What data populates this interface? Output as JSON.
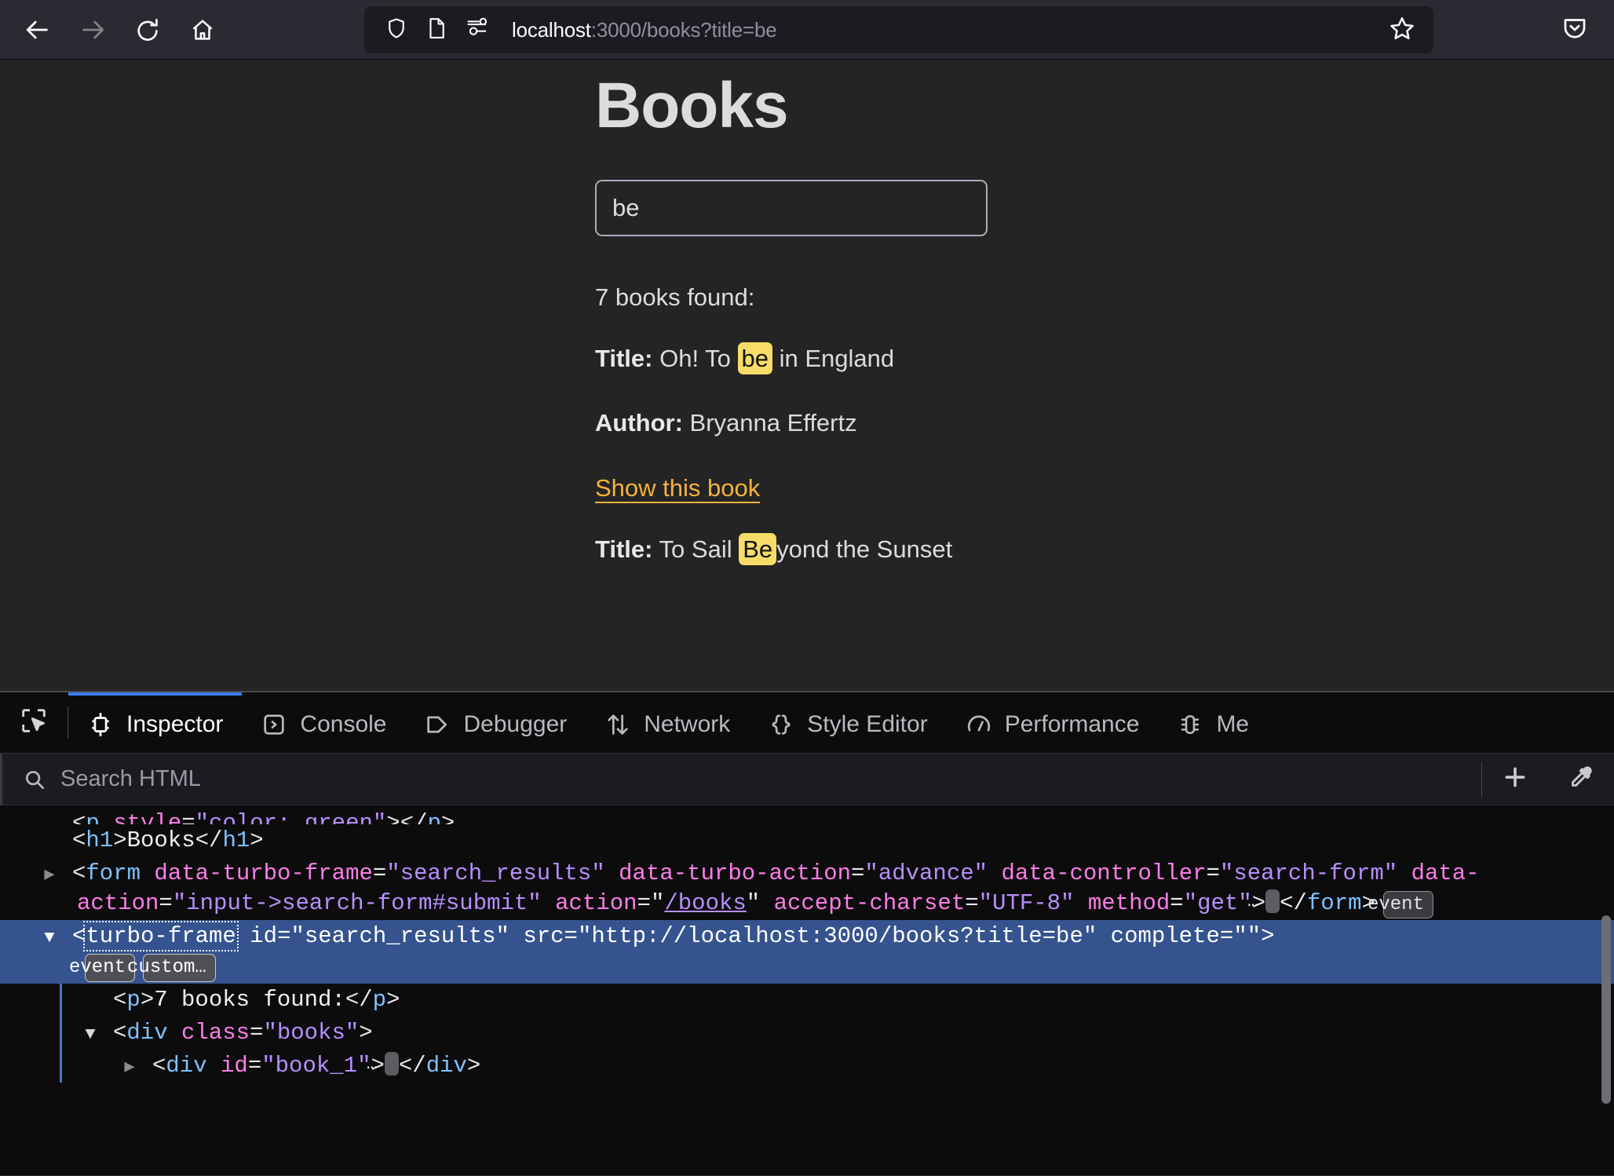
{
  "browser": {
    "nav": {
      "back": "back-arrow",
      "forward": "forward-arrow",
      "reload": "reload-arrow",
      "home": "home-house"
    },
    "url_bar": {
      "shield_icon": "shield-icon",
      "page_icon": "page-document-icon",
      "tracking_icon": "tracking-protection-icon",
      "host": "localhost",
      "path": ":3000/books?title=be",
      "full_url": "localhost:3000/books?title=be",
      "bookmark_icon": "star-icon"
    },
    "pocket_icon": "pocket-icon"
  },
  "page": {
    "title": "Books",
    "search": {
      "value": "be",
      "placeholder": ""
    },
    "results_count": "7 books found:",
    "books": [
      {
        "title_label": "Title:",
        "title_pre": " Oh! To ",
        "title_hl": "be",
        "title_post": " in England",
        "author_label": "Author:",
        "author_name": " Bryanna Effertz",
        "link": "Show this book"
      },
      {
        "title_label": "Title:",
        "title_pre": " To Sail ",
        "title_hl": "Be",
        "title_post": "yond the Sunset"
      }
    ]
  },
  "devtools": {
    "picker_icon": "element-picker-icon",
    "tabs": [
      {
        "label": "Inspector",
        "icon": "inspector-icon",
        "active": true
      },
      {
        "label": "Console",
        "icon": "console-icon",
        "active": false
      },
      {
        "label": "Debugger",
        "icon": "debugger-icon",
        "active": false
      },
      {
        "label": "Network",
        "icon": "network-icon",
        "active": false
      },
      {
        "label": "Style Editor",
        "icon": "style-editor-icon",
        "active": false
      },
      {
        "label": "Performance",
        "icon": "performance-icon",
        "active": false
      },
      {
        "label": "Me",
        "icon": "memory-icon",
        "active": false
      }
    ],
    "search_html": {
      "placeholder": "Search HTML",
      "value": "",
      "icon": "search-icon"
    },
    "add_node_icon": "plus-icon",
    "eyedropper_icon": "eyedropper-icon",
    "markup": {
      "rows": [
        {
          "id": "row-p-style",
          "clipped": true,
          "parts": [
            {
              "t": "punct",
              "v": "<"
            },
            {
              "t": "tag",
              "v": "p"
            },
            {
              "t": "attr",
              "v": " style"
            },
            {
              "t": "punct",
              "v": "="
            },
            {
              "t": "val",
              "v": "\"color: green\""
            },
            {
              "t": "punct",
              "v": ">"
            },
            {
              "t": "punct",
              "v": "</"
            },
            {
              "t": "tag",
              "v": "p"
            },
            {
              "t": "punct",
              "v": ">"
            }
          ]
        },
        {
          "id": "row-h1",
          "parts": [
            {
              "t": "punct",
              "v": "<"
            },
            {
              "t": "tag",
              "v": "h1"
            },
            {
              "t": "punct",
              "v": ">"
            },
            {
              "t": "txt",
              "v": "Books"
            },
            {
              "t": "punct",
              "v": "</"
            },
            {
              "t": "tag",
              "v": "h1"
            },
            {
              "t": "punct",
              "v": ">"
            }
          ]
        },
        {
          "id": "row-form",
          "twisty": "closed",
          "parts": [
            {
              "t": "punct",
              "v": "<"
            },
            {
              "t": "tag",
              "v": "form"
            },
            {
              "t": "attr",
              "v": " data-turbo-frame"
            },
            {
              "t": "punct",
              "v": "="
            },
            {
              "t": "val",
              "v": "\"search_results\""
            },
            {
              "t": "attr",
              "v": " data-turbo-action"
            },
            {
              "t": "punct",
              "v": "="
            },
            {
              "t": "val",
              "v": "\"advance\""
            },
            {
              "t": "attr",
              "v": " data-controller"
            },
            {
              "t": "punct",
              "v": "="
            },
            {
              "t": "val",
              "v": "\"search-form\""
            },
            {
              "t": "attr",
              "v": " data-action"
            },
            {
              "t": "punct",
              "v": "="
            },
            {
              "t": "val",
              "v": "\"input->search-form#submit\""
            },
            {
              "t": "attr",
              "v": " action"
            },
            {
              "t": "punct",
              "v": "="
            },
            {
              "t": "punct",
              "v": "\""
            },
            {
              "t": "val-link",
              "v": "/books"
            },
            {
              "t": "punct",
              "v": "\""
            },
            {
              "t": "attr",
              "v": " accept-charset"
            },
            {
              "t": "punct",
              "v": "="
            },
            {
              "t": "val",
              "v": "\"UTF-8\""
            },
            {
              "t": "attr",
              "v": " method"
            },
            {
              "t": "punct",
              "v": "="
            },
            {
              "t": "val",
              "v": "\"get\""
            },
            {
              "t": "punct",
              "v": ">"
            },
            {
              "t": "ellipsis",
              "v": "…"
            },
            {
              "t": "punct",
              "v": "</"
            },
            {
              "t": "tag",
              "v": "form"
            },
            {
              "t": "punct",
              "v": ">"
            },
            {
              "t": "badge",
              "v": "event"
            }
          ]
        },
        {
          "id": "row-turbo-frame",
          "selected": true,
          "twisty": "open",
          "parts": [
            {
              "t": "punct",
              "v": "<"
            },
            {
              "t": "tag-focus",
              "v": "turbo-frame"
            },
            {
              "t": "attr",
              "v": " id"
            },
            {
              "t": "punct",
              "v": "="
            },
            {
              "t": "val",
              "v": "\"search_results\""
            },
            {
              "t": "attr",
              "v": " src"
            },
            {
              "t": "punct",
              "v": "="
            },
            {
              "t": "val",
              "v": "\"http://localhost:3000/books?title=be\""
            },
            {
              "t": "attr",
              "v": " complete"
            },
            {
              "t": "punct",
              "v": "="
            },
            {
              "t": "val",
              "v": "\"\""
            },
            {
              "t": "punct",
              "v": ">"
            },
            {
              "t": "newline",
              "v": ""
            },
            {
              "t": "badge",
              "v": "event"
            },
            {
              "t": "badge",
              "v": "custom…"
            }
          ]
        },
        {
          "id": "row-p-found",
          "indent": 1,
          "parts": [
            {
              "t": "punct",
              "v": "<"
            },
            {
              "t": "tag",
              "v": "p"
            },
            {
              "t": "punct",
              "v": ">"
            },
            {
              "t": "txt",
              "v": "7 books found:"
            },
            {
              "t": "punct",
              "v": "</"
            },
            {
              "t": "tag",
              "v": "p"
            },
            {
              "t": "punct",
              "v": ">"
            }
          ]
        },
        {
          "id": "row-div-books",
          "indent": 1,
          "twisty": "open",
          "parts": [
            {
              "t": "punct",
              "v": "<"
            },
            {
              "t": "tag",
              "v": "div"
            },
            {
              "t": "attr",
              "v": " class"
            },
            {
              "t": "punct",
              "v": "="
            },
            {
              "t": "val",
              "v": "\"books\""
            },
            {
              "t": "punct",
              "v": ">"
            }
          ]
        },
        {
          "id": "row-div-book1",
          "indent": 2,
          "twisty": "closed",
          "parts": [
            {
              "t": "punct",
              "v": "<"
            },
            {
              "t": "tag",
              "v": "div"
            },
            {
              "t": "attr",
              "v": " id"
            },
            {
              "t": "punct",
              "v": "="
            },
            {
              "t": "val",
              "v": "\"book_1\""
            },
            {
              "t": "punct",
              "v": ">"
            },
            {
              "t": "ellipsis",
              "v": "…"
            },
            {
              "t": "punct",
              "v": "</"
            },
            {
              "t": "tag",
              "v": "div"
            },
            {
              "t": "punct",
              "v": ">"
            }
          ]
        }
      ]
    }
  },
  "colors": {
    "chrome_bg": "#2b2a33",
    "urlbar_bg": "#1c1b22",
    "page_bg": "#242424",
    "devtools_bg": "#0c0c0d",
    "selection_blue": "#35538f",
    "tab_active_underline": "#3d7cf3",
    "highlight_yellow": "#f7dd67",
    "link_orange": "#f5b23c",
    "tag_blue": "#7fc1ff",
    "attr_pink": "#ff7de9",
    "value_purple": "#b98eff"
  }
}
